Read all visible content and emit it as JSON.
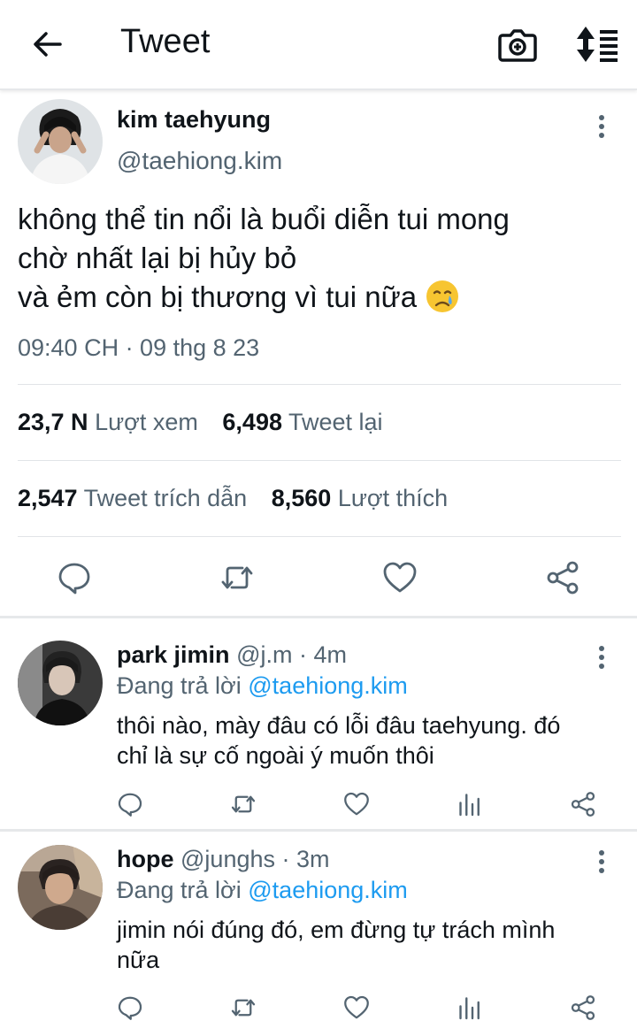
{
  "header": {
    "title": "Tweet"
  },
  "tweet": {
    "author_name": "kim taehyung",
    "author_handle": "@taehiong.kim",
    "text_line1": "không thể tin nổi là buổi diễn tui mong",
    "text_line2": "chờ nhất lại bị hủy bỏ",
    "text_line3": "và ẻm còn bị thương vì tui nữa",
    "emoji": "crying-face",
    "timestamp": "09:40 CH · 09 thg 8 23",
    "views_count": "23,7 N",
    "views_label": "Lượt xem",
    "retweets_count": "6,498",
    "retweets_label": "Tweet lại",
    "quotes_count": "2,547",
    "quotes_label": "Tweet trích dẫn",
    "likes_count": "8,560",
    "likes_label": "Lượt thích"
  },
  "replies": [
    {
      "name": "park jimin",
      "handle": "@j.m",
      "time": "· 4m",
      "replying_prefix": "Đang trả lời ",
      "replying_to": "@taehiong.kim",
      "text_line1": "thôi nào, mày đâu có lỗi đâu taehyung. đó",
      "text_line2": "chỉ là sự cố ngoài ý muốn thôi"
    },
    {
      "name": "hope",
      "handle": "@junghs",
      "time": "· 3m",
      "replying_prefix": "Đang trả lời ",
      "replying_to": "@taehiong.kim",
      "text_line1": "jimin nói đúng đó, em đừng tự trách mình",
      "text_line2": "nữa"
    }
  ],
  "colors": {
    "accent": "#1d9bf0",
    "secondary_text": "#536471",
    "primary_text": "#0f1419"
  },
  "icons": [
    "back-arrow-icon",
    "camera-icon",
    "sort-icon",
    "more-icon",
    "reply-icon",
    "retweet-icon",
    "like-icon",
    "share-icon",
    "analytics-icon"
  ]
}
